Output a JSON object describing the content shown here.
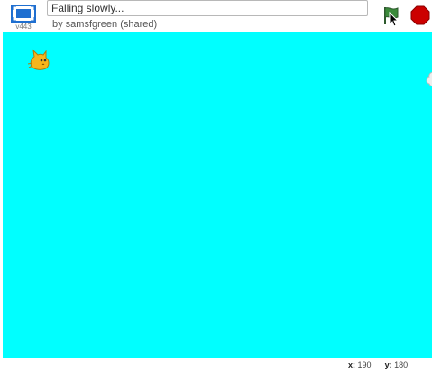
{
  "header": {
    "version_label": "v443",
    "title_value": "Falling slowly...",
    "author_label": "by samsfgreen (shared)"
  },
  "icons": {
    "fullscreen": "fullscreen-icon",
    "green_flag": "green-flag-icon",
    "stop": "stop-sign-icon",
    "cursor": "mouse-pointer-icon",
    "sprite": "cat-sprite"
  },
  "stage": {
    "background_color": "#00ffff"
  },
  "footer": {
    "x_label": "x:",
    "x_value": "190",
    "y_label": "y:",
    "y_value": "180"
  },
  "colors": {
    "accent_blue": "#1f6fd0",
    "flag_green": "#3b8a3b",
    "stop_red": "#cc0000"
  }
}
